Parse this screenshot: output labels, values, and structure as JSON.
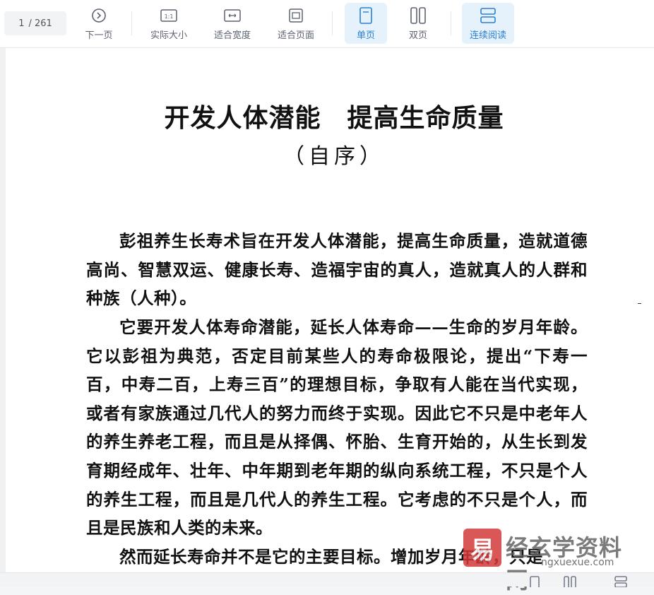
{
  "toolbar": {
    "page_current": "1",
    "page_total": "/ 261",
    "buttons": [
      {
        "label": "下一页",
        "icon": "next-page-icon"
      },
      {
        "label": "实际大小",
        "icon": "actual-size-icon"
      },
      {
        "label": "适合宽度",
        "icon": "fit-width-icon"
      },
      {
        "label": "适合页面",
        "icon": "fit-page-icon"
      },
      {
        "label": "单页",
        "icon": "single-page-icon"
      },
      {
        "label": "双页",
        "icon": "double-page-icon"
      },
      {
        "label": "连续阅读",
        "icon": "continuous-read-icon"
      }
    ],
    "actual_size_icon_text": "1:1",
    "accent_color": "#2b7fd3"
  },
  "document": {
    "title": "开发人体潜能　提高生命质量",
    "subtitle": "（自序）",
    "paragraphs": [
      "彭祖养生长寿术旨在开发人体潜能，提高生命质量，造就道德高尚、智慧双运、健康长寿、造福宇宙的真人，造就真人的人群和种族（人种）。",
      "它要开发人体寿命潜能，延长人体寿命——生命的岁月年龄。它以彭祖为典范，否定目前某些人的寿命极限论，提出“下寿一百，中寿二百，上寿三百”的理想目标，争取有人能在当代实现，或者有家族通过几代人的努力而终于实现。因此它不只是中老年人的养生养老工程，而且是从择偶、怀胎、生育开始的，从生长到发育期经成年、壮年、中年期到老年期的纵向系统工程，不只是个人的养生工程，而且是几代人的养生工程。它考虑的不只是个人，而且是民族和人类的未来。",
      "然而延长寿命并不是它的主要目标。增加岁月年龄，只是"
    ]
  },
  "watermark": {
    "logo_char": "易",
    "text": "经玄学资料网",
    "url": "ngxuexue.com"
  }
}
